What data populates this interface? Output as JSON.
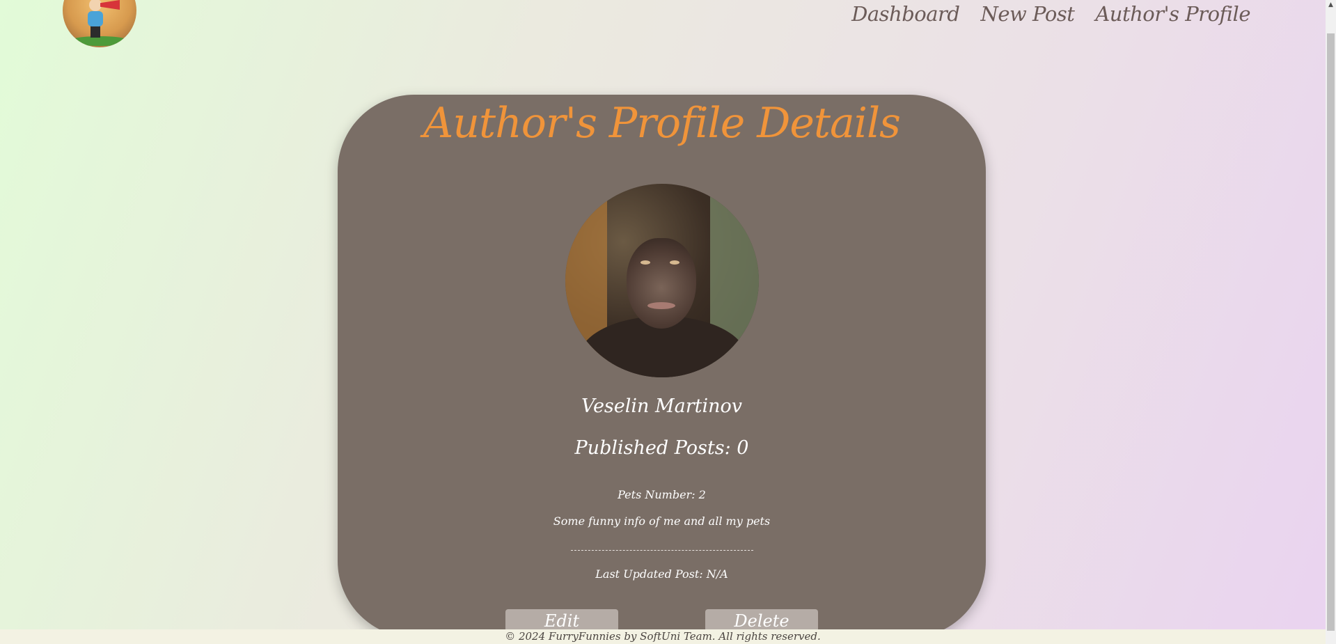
{
  "nav": {
    "dashboard": "Dashboard",
    "new_post": "New Post",
    "authors_profile": "Author's Profile"
  },
  "profile": {
    "title": "Author's Profile Details",
    "name": "Veselin Martinov",
    "published_posts": "Published Posts: 0",
    "pets_number": "Pets Number: 2",
    "bio": "Some funny info of me and all my pets",
    "last_updated": "Last Updated Post: N/A"
  },
  "actions": {
    "edit": "Edit",
    "delete": "Delete"
  },
  "footer": {
    "text": "© 2024 FurryFunnies by SoftUni Team. All rights reserved."
  },
  "icons": {
    "logo": "cartoon-kid-megaphone-logo",
    "avatar": "chimpanzee-avatar",
    "scroll_up": "arrow-up-icon"
  },
  "colors": {
    "title_accent": "#f0943a",
    "card_bg": "#7a6e66",
    "button_bg": "#b5aca6",
    "nav_text": "#6b5b58"
  }
}
